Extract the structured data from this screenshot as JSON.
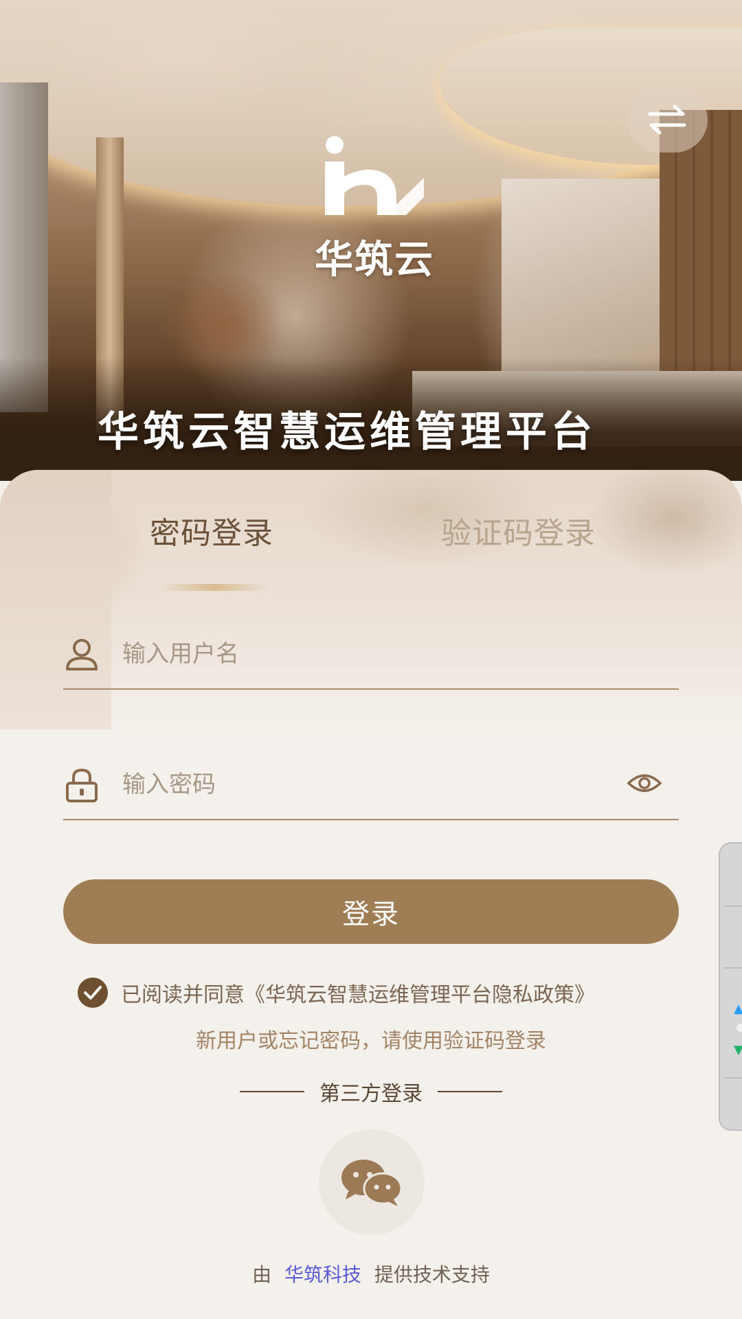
{
  "header": {
    "logo_text": "华筑云",
    "platform_title": "华筑云智慧运维管理平台",
    "switch_icon": "swap-arrows-icon"
  },
  "tabs": [
    {
      "label": "密码登录",
      "active": true
    },
    {
      "label": "验证码登录",
      "active": false
    }
  ],
  "form": {
    "username_placeholder": "输入用户名",
    "username_value": "",
    "password_placeholder": "输入密码",
    "password_value": "",
    "login_label": "登录"
  },
  "agreement": {
    "checked": true,
    "prefix": "已阅读并同意",
    "policy_link": "《华筑云智慧运维管理平台隐私政策》"
  },
  "tip": "新用户或忘记密码，请使用验证码登录",
  "third_party": {
    "label": "第三方登录",
    "wechat_icon": "wechat-icon"
  },
  "footer": {
    "prefix": "由",
    "brand": "华筑科技",
    "suffix": "提供技术支持"
  },
  "colors": {
    "accent": "#a07e55",
    "active_tab": "#6b5138",
    "inactive_tab": "#b9a48d",
    "footer_link": "#5b5bd6"
  }
}
